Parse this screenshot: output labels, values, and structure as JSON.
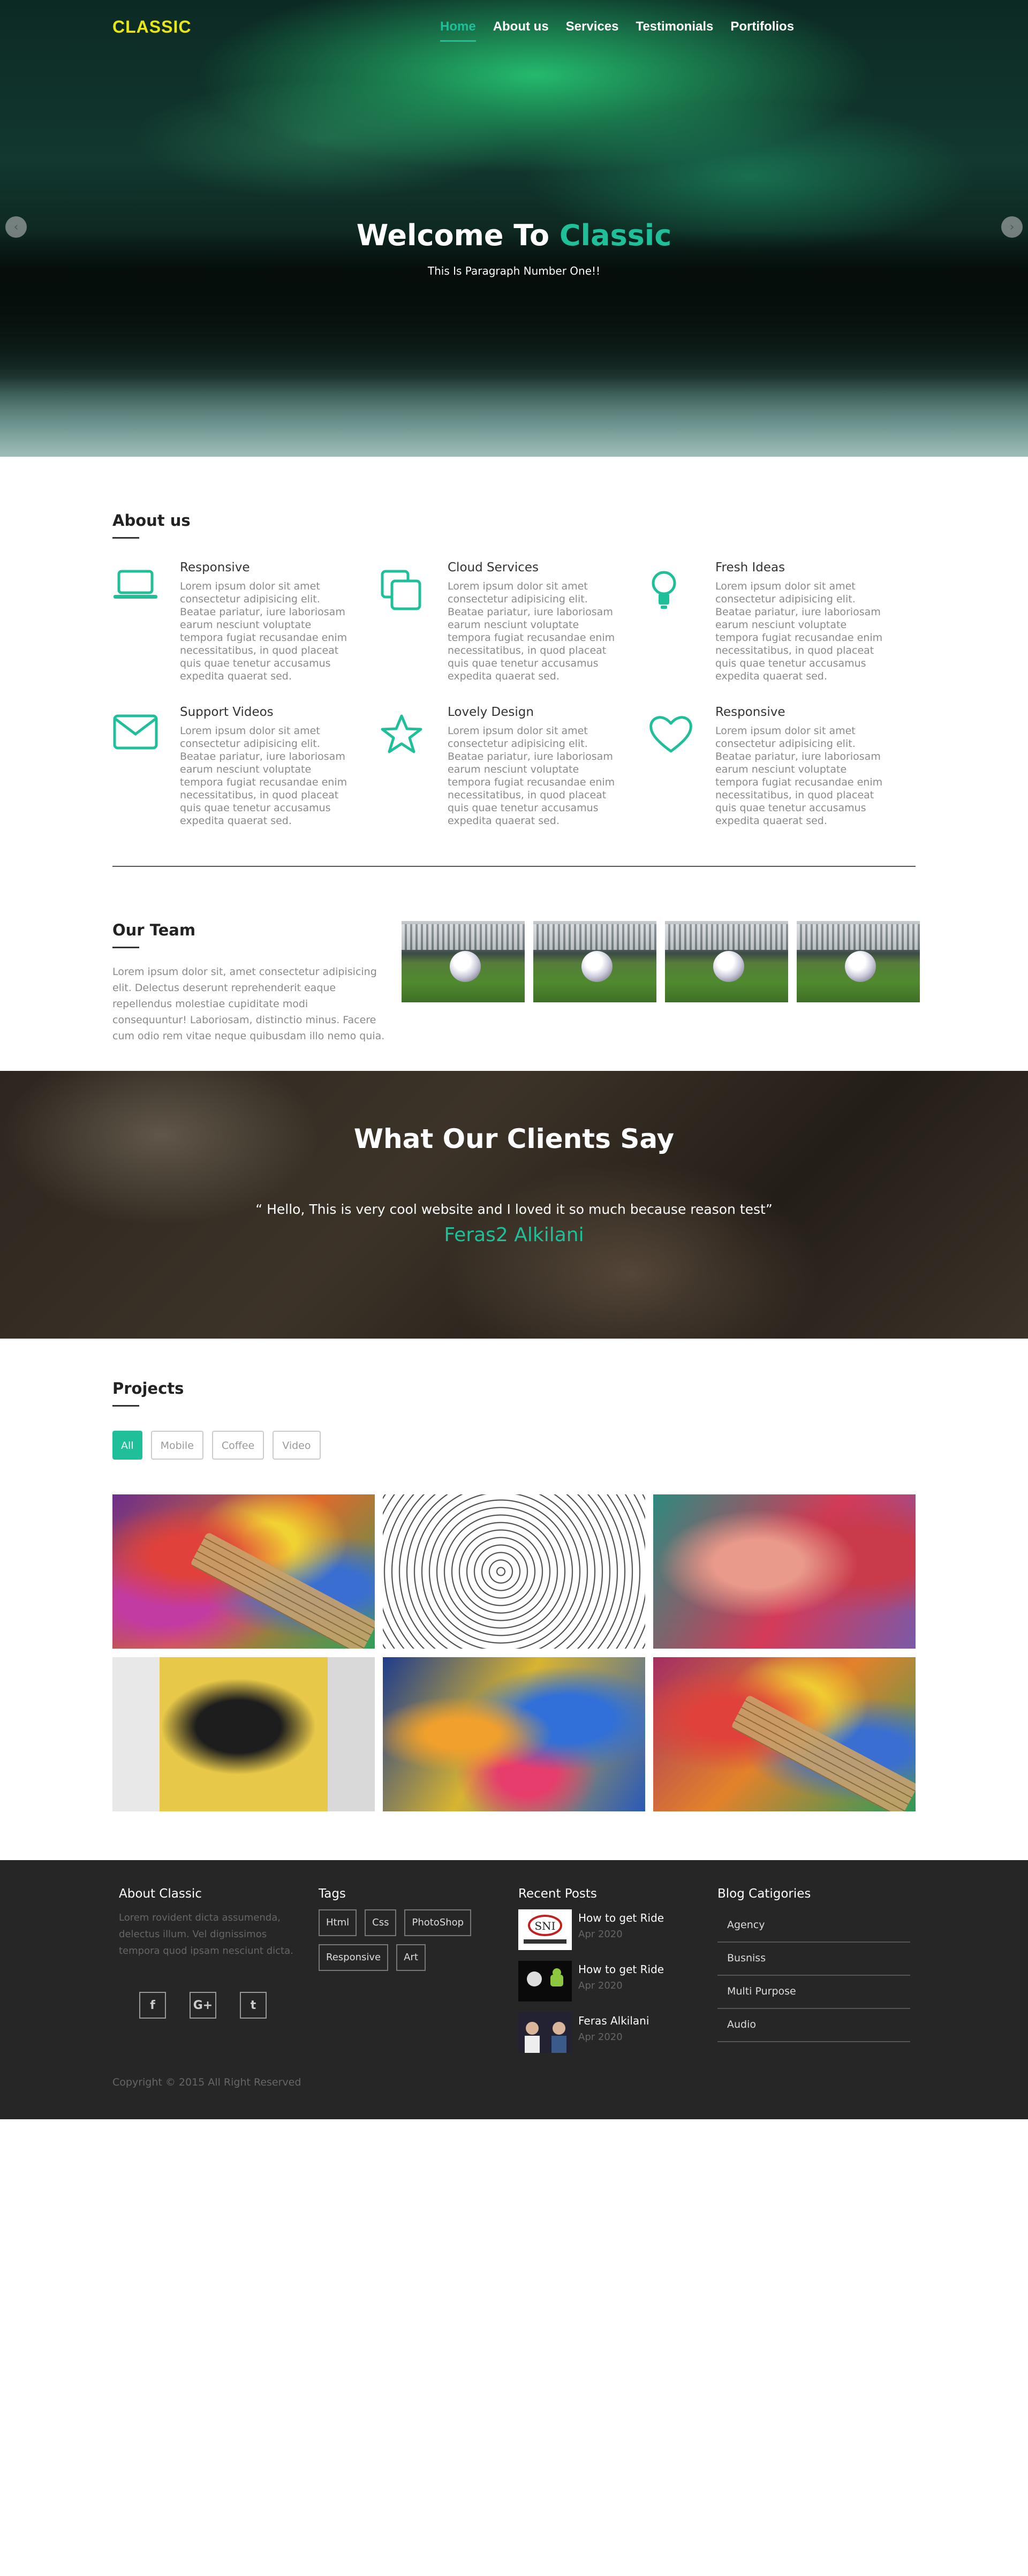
{
  "brand": {
    "logo": "CLASSIC",
    "logo_color": "#e8e614",
    "accent_color": "#1fbf9a"
  },
  "nav": {
    "items": [
      "Home",
      "About us",
      "Services",
      "Testimonials",
      "Portifolios"
    ],
    "active": "Home"
  },
  "hero": {
    "title_prefix": "Welcome To",
    "title_accent": "Classic",
    "subtitle": "This Is Paragraph Number One!!",
    "prev_icon": "chevron-left-icon",
    "next_icon": "chevron-right-icon"
  },
  "about": {
    "title": "About us",
    "features": [
      {
        "icon": "laptop-icon",
        "title": "Responsive",
        "text": "Lorem ipsum dolor sit amet consectetur adipisicing elit. Beatae pariatur, iure laboriosam earum nesciunt voluptate tempora fugiat recusandae enim necessitatibus, in quod placeat quis quae tenetur accusamus expedita quaerat sed."
      },
      {
        "icon": "copy-icon",
        "title": "Cloud Services",
        "text": "Lorem ipsum dolor sit amet consectetur adipisicing elit. Beatae pariatur, iure laboriosam earum nesciunt voluptate tempora fugiat recusandae enim necessitatibus, in quod placeat quis quae tenetur accusamus expedita quaerat sed."
      },
      {
        "icon": "lightbulb-icon",
        "title": "Fresh Ideas",
        "text": "Lorem ipsum dolor sit amet consectetur adipisicing elit. Beatae pariatur, iure laboriosam earum nesciunt voluptate tempora fugiat recusandae enim necessitatibus, in quod placeat quis quae tenetur accusamus expedita quaerat sed."
      },
      {
        "icon": "envelope-icon",
        "title": "Support Videos",
        "text": "Lorem ipsum dolor sit amet consectetur adipisicing elit. Beatae pariatur, iure laboriosam earum nesciunt voluptate tempora fugiat recusandae enim necessitatibus, in quod placeat quis quae tenetur accusamus expedita quaerat sed."
      },
      {
        "icon": "star-icon",
        "title": "Lovely Design",
        "text": "Lorem ipsum dolor sit amet consectetur adipisicing elit. Beatae pariatur, iure laboriosam earum nesciunt voluptate tempora fugiat recusandae enim necessitatibus, in quod placeat quis quae tenetur accusamus expedita quaerat sed."
      },
      {
        "icon": "heart-icon",
        "title": "Responsive",
        "text": "Lorem ipsum dolor sit amet consectetur adipisicing elit. Beatae pariatur, iure laboriosam earum nesciunt voluptate tempora fugiat recusandae enim necessitatibus, in quod placeat quis quae tenetur accusamus expedita quaerat sed."
      }
    ]
  },
  "team": {
    "title": "Our Team",
    "text": "Lorem ipsum dolor sit, amet consectetur adipisicing elit. Delectus deserunt reprehenderit eaque repellendus molestiae cupiditate modi consequuntur! Laboriosam, distinctio minus. Facere cum odio rem vitae neque quibusdam illo nemo quia."
  },
  "testimonials": {
    "title": "What Our Clients Say",
    "quote": "“ Hello, This is very cool website and I loved it so much because reason test”",
    "author": "Feras2 Alkilani"
  },
  "projects": {
    "title": "Projects",
    "filters": [
      "All",
      "Mobile",
      "Coffee",
      "Video"
    ],
    "active_filter": "All"
  },
  "footer": {
    "about_title": "About Classic",
    "about_text": "Lorem rovident dicta assumenda, delectus illum. Vel dignissimos tempora quod ipsam nesciunt dicta.",
    "social": [
      {
        "icon": "facebook-icon",
        "glyph": "f"
      },
      {
        "icon": "google-plus-icon",
        "glyph": "G+"
      },
      {
        "icon": "twitter-icon",
        "glyph": "t"
      }
    ],
    "tags_title": "Tags",
    "tags": [
      "Html",
      "Css",
      "PhotoShop",
      "Responsive",
      "Art"
    ],
    "posts_title": "Recent Posts",
    "posts": [
      {
        "title": "How to get Ride",
        "date": "Apr 2020"
      },
      {
        "title": "How to get Ride",
        "date": "Apr 2020"
      },
      {
        "title": "Feras Alkilani",
        "date": "Apr 2020"
      }
    ],
    "cats_title": "Blog Catigories",
    "categories": [
      "Agency",
      "Busniss",
      "Multi Purpose",
      "Audio"
    ],
    "copyright": "Copyright © 2015 All Right Reserved"
  }
}
